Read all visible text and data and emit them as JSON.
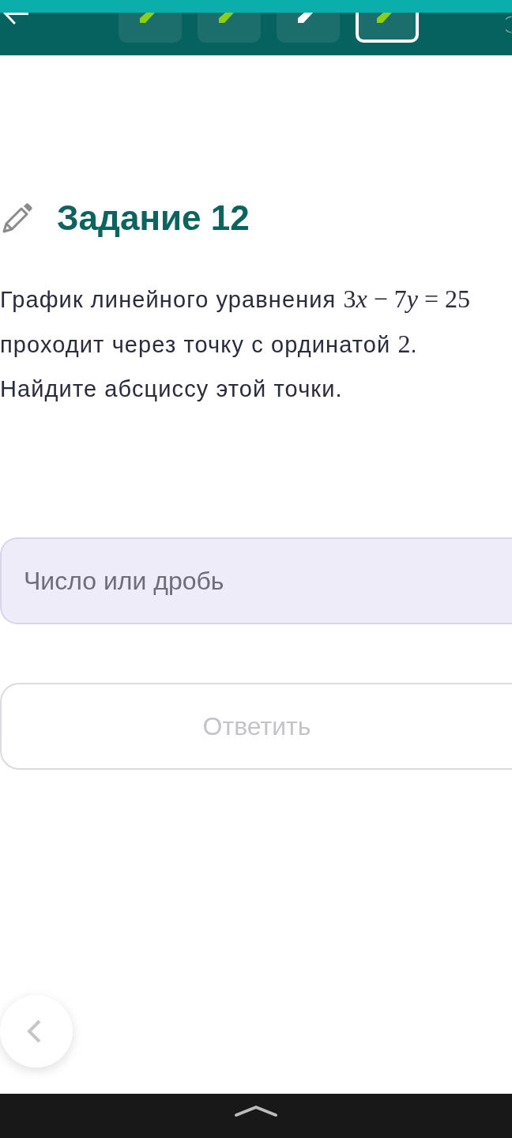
{
  "header": {
    "tasks": [
      {
        "selected": false,
        "color": "#8ccf14"
      },
      {
        "selected": false,
        "color": "#8ccf14"
      },
      {
        "selected": false,
        "color": "#ffffff"
      },
      {
        "selected": true,
        "color": "#8ccf14"
      }
    ]
  },
  "task": {
    "title": "Задание 12",
    "statement": [
      {
        "kind": "text",
        "text": "График линейного уравнения "
      },
      {
        "kind": "formula",
        "parts": [
          {
            "kind": "number",
            "text": "3"
          },
          {
            "kind": "variable",
            "text": "x"
          },
          {
            "kind": "operator",
            "text": " − "
          },
          {
            "kind": "number",
            "text": "7"
          },
          {
            "kind": "variable",
            "text": "y"
          },
          {
            "kind": "operator",
            "text": " = "
          },
          {
            "kind": "number",
            "text": "25"
          }
        ]
      },
      {
        "kind": "text",
        "text": " проходит через точку с ординатой "
      },
      {
        "kind": "formula",
        "parts": [
          {
            "kind": "number",
            "text": "2"
          }
        ]
      },
      {
        "kind": "text",
        "text": "."
      }
    ],
    "question": "Найдите абсциссу этой точки.",
    "answer_field": {
      "placeholder": "Число или дробь"
    },
    "submit_button": {
      "label": "Ответить",
      "disabled": true
    }
  }
}
